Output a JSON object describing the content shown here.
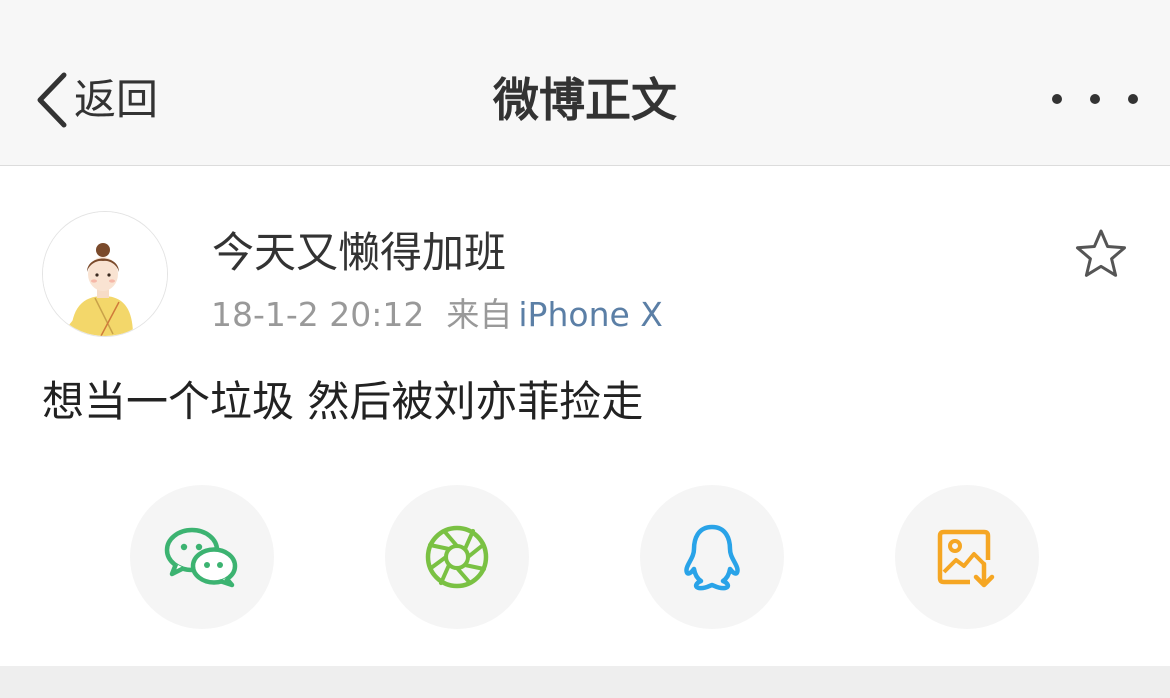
{
  "navbar": {
    "back_label": "返回",
    "title": "微博正文",
    "more_icon": "more-dots-icon"
  },
  "post": {
    "username": "今天又懒得加班",
    "time": "18-1-2 20:12",
    "source_prefix": "来自",
    "source": "iPhone X",
    "text": "想当一个垃圾 然后被刘亦菲捡走",
    "avatar_icon": "user-avatar-illustration",
    "favorite_icon": "star-outline-icon"
  },
  "share": {
    "items": [
      {
        "icon": "wechat-icon",
        "color": "#3cb371"
      },
      {
        "icon": "moments-icon",
        "color": "#7ac143"
      },
      {
        "icon": "qq-icon",
        "color": "#29a3e8"
      },
      {
        "icon": "save-image-icon",
        "color": "#f5a623"
      }
    ]
  },
  "colors": {
    "source_link": "#5b7fa6",
    "navbar_bg": "#f7f7f7",
    "share_circle_bg": "#f5f5f5"
  }
}
